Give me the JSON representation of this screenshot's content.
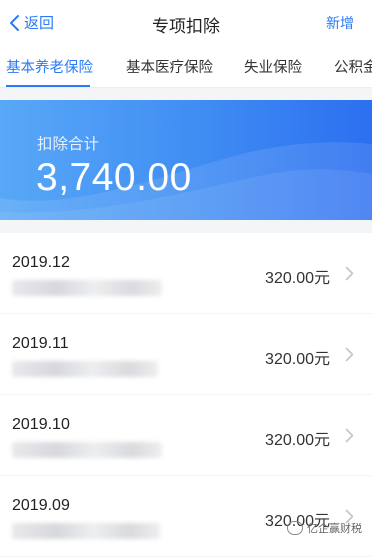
{
  "nav": {
    "back_label": "返回",
    "title": "专项扣除",
    "add_label": "新增"
  },
  "tabs": [
    {
      "label": "基本养老保险",
      "active": true
    },
    {
      "label": "基本医疗保险",
      "active": false
    },
    {
      "label": "失业保险",
      "active": false
    },
    {
      "label": "公积金",
      "active": false
    }
  ],
  "summary": {
    "label": "扣除合计",
    "amount": "3,740.00"
  },
  "records": [
    {
      "period": "2019.12",
      "amount": "320.00元"
    },
    {
      "period": "2019.11",
      "amount": "320.00元"
    },
    {
      "period": "2019.10",
      "amount": "320.00元"
    },
    {
      "period": "2019.09",
      "amount": "320.00元"
    }
  ],
  "watermark": "亿企赢财税",
  "colors": {
    "accent": "#2b7af6",
    "banner_start": "#58a8f7",
    "banner_end": "#2c6ff0"
  }
}
